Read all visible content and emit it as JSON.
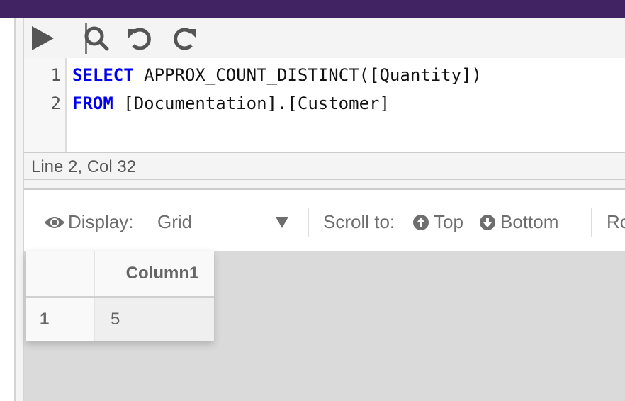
{
  "toolbar": {
    "buttons": [
      {
        "name": "run",
        "icon": "play-icon"
      },
      {
        "name": "search",
        "icon": "search-icon"
      },
      {
        "name": "undo",
        "icon": "undo-icon"
      },
      {
        "name": "redo",
        "icon": "redo-icon"
      }
    ]
  },
  "editor": {
    "lines": [
      {
        "number": "1",
        "keyword": "SELECT",
        "rest": " APPROX_COUNT_DISTINCT([Quantity])"
      },
      {
        "number": "2",
        "keyword": "FROM",
        "rest": " [Documentation].[Customer]"
      }
    ]
  },
  "status": {
    "cursor": "Line 2, Col 32"
  },
  "results_bar": {
    "display_label": "Display:",
    "display_value": "Grid",
    "scroll_label": "Scroll to:",
    "top_label": "Top",
    "bottom_label": "Bottom",
    "truncated_label": "Ro"
  },
  "grid": {
    "columns": [
      "Column1"
    ],
    "rows": [
      {
        "row_number": "1",
        "values": [
          "5"
        ]
      }
    ]
  },
  "colors": {
    "topbar": "#412263",
    "keyword": "#0000ee"
  }
}
